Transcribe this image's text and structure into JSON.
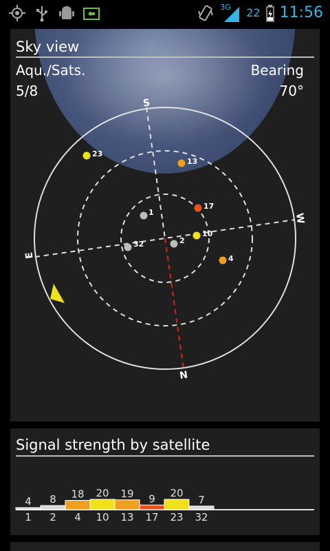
{
  "status_bar": {
    "left_icons": [
      "gps-icon",
      "usb-icon",
      "android-debug-icon",
      "sdcard-icon"
    ],
    "network_type": "3G",
    "battery_percent": "22",
    "time": "11:56"
  },
  "sky_view": {
    "title": "Sky view",
    "aqu_sats_label": "Aqu./Sats.",
    "aqu_sats_value": "5/8",
    "bearing_label": "Bearing",
    "bearing_value": "70°",
    "compass": {
      "north": "N",
      "south": "S",
      "east": "E",
      "west": "W"
    },
    "satellites": [
      {
        "id": "23",
        "color": "#f0e21a"
      },
      {
        "id": "13",
        "color": "#f0a020"
      },
      {
        "id": "17",
        "color": "#e8541c"
      },
      {
        "id": "1",
        "color": "#bdbdbd"
      },
      {
        "id": "10",
        "color": "#f0e21a"
      },
      {
        "id": "2",
        "color": "#bdbdbd"
      },
      {
        "id": "32",
        "color": "#bdbdbd"
      },
      {
        "id": "4",
        "color": "#f0a020"
      }
    ]
  },
  "signal_strength": {
    "title": "Signal strength by satellite",
    "bars": [
      {
        "sat": "1",
        "value": "4",
        "color": "#d8d8d8"
      },
      {
        "sat": "2",
        "value": "8",
        "color": "#d8d8d8"
      },
      {
        "sat": "4",
        "value": "18",
        "color": "#f0a020"
      },
      {
        "sat": "10",
        "value": "20",
        "color": "#f0e21a"
      },
      {
        "sat": "13",
        "value": "19",
        "color": "#f0a020"
      },
      {
        "sat": "17",
        "value": "9",
        "color": "#e8541c"
      },
      {
        "sat": "23",
        "value": "20",
        "color": "#f0e21a"
      },
      {
        "sat": "32",
        "value": "7",
        "color": "#d8d8d8"
      }
    ]
  },
  "colors": {
    "accent": "#33b5e5",
    "panel_bg": "#1f1f1f",
    "north_line": "#e02020"
  }
}
